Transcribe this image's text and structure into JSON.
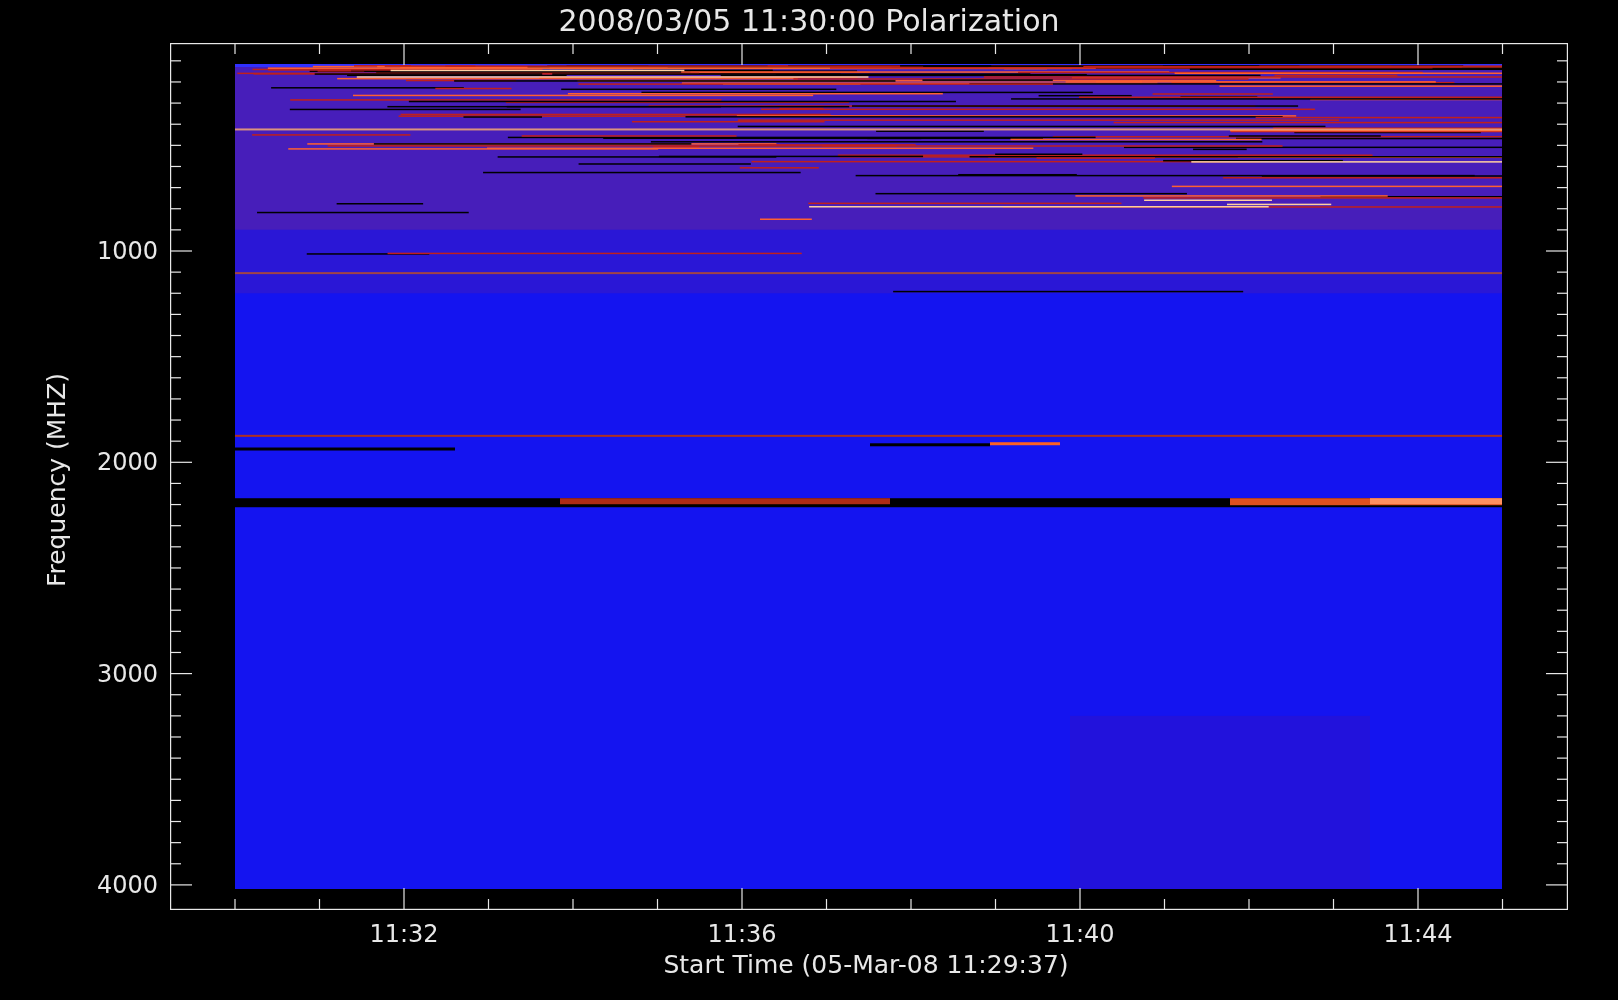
{
  "title": "2008/03/05 11:30:00 Polarization",
  "y_axis": {
    "label": "Frequency (MHZ)",
    "ticks": [
      "1000",
      "2000",
      "3000",
      "4000"
    ]
  },
  "x_axis": {
    "label": "Start Time (05-Mar-08 11:29:37)",
    "ticks": [
      "11:32",
      "11:36",
      "11:40",
      "11:44"
    ]
  }
}
